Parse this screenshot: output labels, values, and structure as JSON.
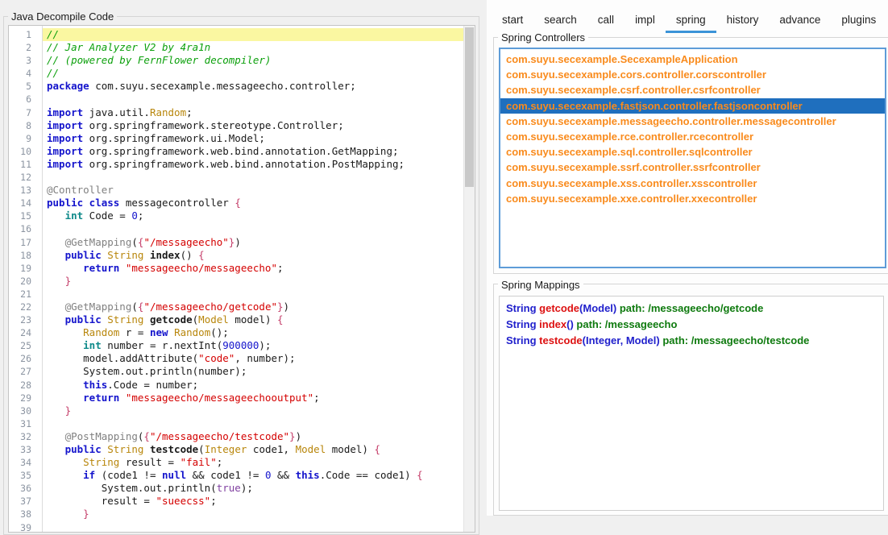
{
  "colors": {
    "accent_tab_underline": "#3b93d8",
    "list_focus_border": "#5e9cd8",
    "selected_row_bg": "#1f6fbe",
    "controller_item_text": "#f98b1d",
    "current_line_highlight": "#faf7a1",
    "mapping_return_type": "#2020cc",
    "mapping_method_name": "#dd1111",
    "mapping_path": "#0e7a0e"
  },
  "left_panel": {
    "title": "Java Decompile Code",
    "code": {
      "lines": [
        {
          "n": 1,
          "highlight": true,
          "tokens": [
            [
              "c",
              "//"
            ]
          ]
        },
        {
          "n": 2,
          "tokens": [
            [
              "c",
              "// Jar Analyzer V2 by 4ra1n"
            ]
          ]
        },
        {
          "n": 3,
          "tokens": [
            [
              "c",
              "// (powered by FernFlower decompiler)"
            ]
          ]
        },
        {
          "n": 4,
          "tokens": [
            [
              "c",
              "//"
            ]
          ]
        },
        {
          "n": 5,
          "tokens": [
            [
              "k",
              "package"
            ],
            [
              "p",
              " com.suyu.secexample.messageecho.controller;"
            ]
          ]
        },
        {
          "n": 6,
          "tokens": []
        },
        {
          "n": 7,
          "tokens": [
            [
              "k",
              "import"
            ],
            [
              "p",
              " java.util."
            ],
            [
              "g",
              "Random"
            ],
            [
              "p",
              ";"
            ]
          ]
        },
        {
          "n": 8,
          "tokens": [
            [
              "k",
              "import"
            ],
            [
              "p",
              " org.springframework.stereotype.Controller;"
            ]
          ]
        },
        {
          "n": 9,
          "tokens": [
            [
              "k",
              "import"
            ],
            [
              "p",
              " org.springframework.ui.Model;"
            ]
          ]
        },
        {
          "n": 10,
          "tokens": [
            [
              "k",
              "import"
            ],
            [
              "p",
              " org.springframework.web.bind.annotation.GetMapping;"
            ]
          ]
        },
        {
          "n": 11,
          "tokens": [
            [
              "k",
              "import"
            ],
            [
              "p",
              " org.springframework.web.bind.annotation.PostMapping;"
            ]
          ]
        },
        {
          "n": 12,
          "tokens": []
        },
        {
          "n": 13,
          "tokens": [
            [
              "a",
              "@Controller"
            ]
          ]
        },
        {
          "n": 14,
          "tokens": [
            [
              "k",
              "public class"
            ],
            [
              "p",
              " messagecontroller "
            ],
            [
              "b",
              "{"
            ]
          ]
        },
        {
          "n": 15,
          "tokens": [
            [
              "p",
              "   "
            ],
            [
              "t",
              "int"
            ],
            [
              "p",
              " Code = "
            ],
            [
              "n",
              "0"
            ],
            [
              "p",
              ";"
            ]
          ]
        },
        {
          "n": 16,
          "tokens": []
        },
        {
          "n": 17,
          "tokens": [
            [
              "p",
              "   "
            ],
            [
              "a",
              "@GetMapping"
            ],
            [
              "p",
              "("
            ],
            [
              "b",
              "{"
            ],
            [
              "s",
              "\"/messageecho\""
            ],
            [
              "b",
              "}"
            ],
            [
              "p",
              ")"
            ]
          ]
        },
        {
          "n": 18,
          "tokens": [
            [
              "p",
              "   "
            ],
            [
              "k",
              "public"
            ],
            [
              "p",
              " "
            ],
            [
              "g",
              "String"
            ],
            [
              "p",
              " "
            ],
            [
              "m",
              "index"
            ],
            [
              "p",
              "() "
            ],
            [
              "b",
              "{"
            ]
          ]
        },
        {
          "n": 19,
          "tokens": [
            [
              "p",
              "      "
            ],
            [
              "k",
              "return"
            ],
            [
              "p",
              " "
            ],
            [
              "s",
              "\"messageecho/messageecho\""
            ],
            [
              "p",
              ";"
            ]
          ]
        },
        {
          "n": 20,
          "tokens": [
            [
              "p",
              "   "
            ],
            [
              "b",
              "}"
            ]
          ]
        },
        {
          "n": 21,
          "tokens": []
        },
        {
          "n": 22,
          "tokens": [
            [
              "p",
              "   "
            ],
            [
              "a",
              "@GetMapping"
            ],
            [
              "p",
              "("
            ],
            [
              "b",
              "{"
            ],
            [
              "s",
              "\"/messageecho/getcode\""
            ],
            [
              "b",
              "}"
            ],
            [
              "p",
              ")"
            ]
          ]
        },
        {
          "n": 23,
          "tokens": [
            [
              "p",
              "   "
            ],
            [
              "k",
              "public"
            ],
            [
              "p",
              " "
            ],
            [
              "g",
              "String"
            ],
            [
              "p",
              " "
            ],
            [
              "m",
              "getcode"
            ],
            [
              "p",
              "("
            ],
            [
              "g",
              "Model"
            ],
            [
              "p",
              " model) "
            ],
            [
              "b",
              "{"
            ]
          ]
        },
        {
          "n": 24,
          "tokens": [
            [
              "p",
              "      "
            ],
            [
              "g",
              "Random"
            ],
            [
              "p",
              " r = "
            ],
            [
              "k",
              "new"
            ],
            [
              "p",
              " "
            ],
            [
              "g",
              "Random"
            ],
            [
              "p",
              "();"
            ]
          ]
        },
        {
          "n": 25,
          "tokens": [
            [
              "p",
              "      "
            ],
            [
              "t",
              "int"
            ],
            [
              "p",
              " number = r.nextInt("
            ],
            [
              "n",
              "900000"
            ],
            [
              "p",
              ");"
            ]
          ]
        },
        {
          "n": 26,
          "tokens": [
            [
              "p",
              "      model.addAttribute("
            ],
            [
              "s",
              "\"code\""
            ],
            [
              "p",
              ", number);"
            ]
          ]
        },
        {
          "n": 27,
          "tokens": [
            [
              "p",
              "      System.out.println(number);"
            ]
          ]
        },
        {
          "n": 28,
          "tokens": [
            [
              "p",
              "      "
            ],
            [
              "k",
              "this"
            ],
            [
              "p",
              ".Code = number;"
            ]
          ]
        },
        {
          "n": 29,
          "tokens": [
            [
              "p",
              "      "
            ],
            [
              "k",
              "return"
            ],
            [
              "p",
              " "
            ],
            [
              "s",
              "\"messageecho/messageechooutput\""
            ],
            [
              "p",
              ";"
            ]
          ]
        },
        {
          "n": 30,
          "tokens": [
            [
              "p",
              "   "
            ],
            [
              "b",
              "}"
            ]
          ]
        },
        {
          "n": 31,
          "tokens": []
        },
        {
          "n": 32,
          "tokens": [
            [
              "p",
              "   "
            ],
            [
              "a",
              "@PostMapping"
            ],
            [
              "p",
              "("
            ],
            [
              "b",
              "{"
            ],
            [
              "s",
              "\"/messageecho/testcode\""
            ],
            [
              "b",
              "}"
            ],
            [
              "p",
              ")"
            ]
          ]
        },
        {
          "n": 33,
          "tokens": [
            [
              "p",
              "   "
            ],
            [
              "k",
              "public"
            ],
            [
              "p",
              " "
            ],
            [
              "g",
              "String"
            ],
            [
              "p",
              " "
            ],
            [
              "m",
              "testcode"
            ],
            [
              "p",
              "("
            ],
            [
              "g",
              "Integer"
            ],
            [
              "p",
              " code1, "
            ],
            [
              "g",
              "Model"
            ],
            [
              "p",
              " model) "
            ],
            [
              "b",
              "{"
            ]
          ]
        },
        {
          "n": 34,
          "tokens": [
            [
              "p",
              "      "
            ],
            [
              "g",
              "String"
            ],
            [
              "p",
              " result = "
            ],
            [
              "s",
              "\"fail\""
            ],
            [
              "p",
              ";"
            ]
          ]
        },
        {
          "n": 35,
          "tokens": [
            [
              "p",
              "      "
            ],
            [
              "k",
              "if"
            ],
            [
              "p",
              " (code1 != "
            ],
            [
              "k",
              "null"
            ],
            [
              "p",
              " && code1 != "
            ],
            [
              "n",
              "0"
            ],
            [
              "p",
              " && "
            ],
            [
              "k",
              "this"
            ],
            [
              "p",
              ".Code == code1) "
            ],
            [
              "b",
              "{"
            ]
          ]
        },
        {
          "n": 36,
          "tokens": [
            [
              "p",
              "         System.out.println("
            ],
            [
              "o",
              "true"
            ],
            [
              "p",
              ");"
            ]
          ]
        },
        {
          "n": 37,
          "tokens": [
            [
              "p",
              "         result = "
            ],
            [
              "s",
              "\"sueecss\""
            ],
            [
              "p",
              ";"
            ]
          ]
        },
        {
          "n": 38,
          "tokens": [
            [
              "p",
              "      "
            ],
            [
              "b",
              "}"
            ]
          ]
        },
        {
          "n": 39,
          "tokens": []
        }
      ]
    }
  },
  "right_panel": {
    "tabs": {
      "items": [
        "start",
        "search",
        "call",
        "impl",
        "spring",
        "history",
        "advance",
        "plugins"
      ],
      "active": "spring"
    },
    "controllers": {
      "title": "Spring Controllers",
      "selected_index": 3,
      "items": [
        "com.suyu.secexample.SecexampleApplication",
        "com.suyu.secexample.cors.controller.corscontroller",
        "com.suyu.secexample.csrf.controller.csrfcontroller",
        "com.suyu.secexample.fastjson.controller.fastjsoncontroller",
        "com.suyu.secexample.messageecho.controller.messagecontroller",
        "com.suyu.secexample.rce.controller.rcecontroller",
        "com.suyu.secexample.sql.controller.sqlcontroller",
        "com.suyu.secexample.ssrf.controller.ssrfcontroller",
        "com.suyu.secexample.xss.controller.xsscontroller",
        "com.suyu.secexample.xxe.controller.xxecontroller"
      ]
    },
    "mappings": {
      "title": "Spring Mappings",
      "items": [
        {
          "ret": "String",
          "method": "getcode",
          "params": "(Model)",
          "path": "path: /messageecho/getcode"
        },
        {
          "ret": "String",
          "method": "index",
          "params": "()",
          "path": "path: /messageecho"
        },
        {
          "ret": "String",
          "method": "testcode",
          "params": "(Integer, Model)",
          "path": "path: /messageecho/testcode"
        }
      ]
    }
  }
}
